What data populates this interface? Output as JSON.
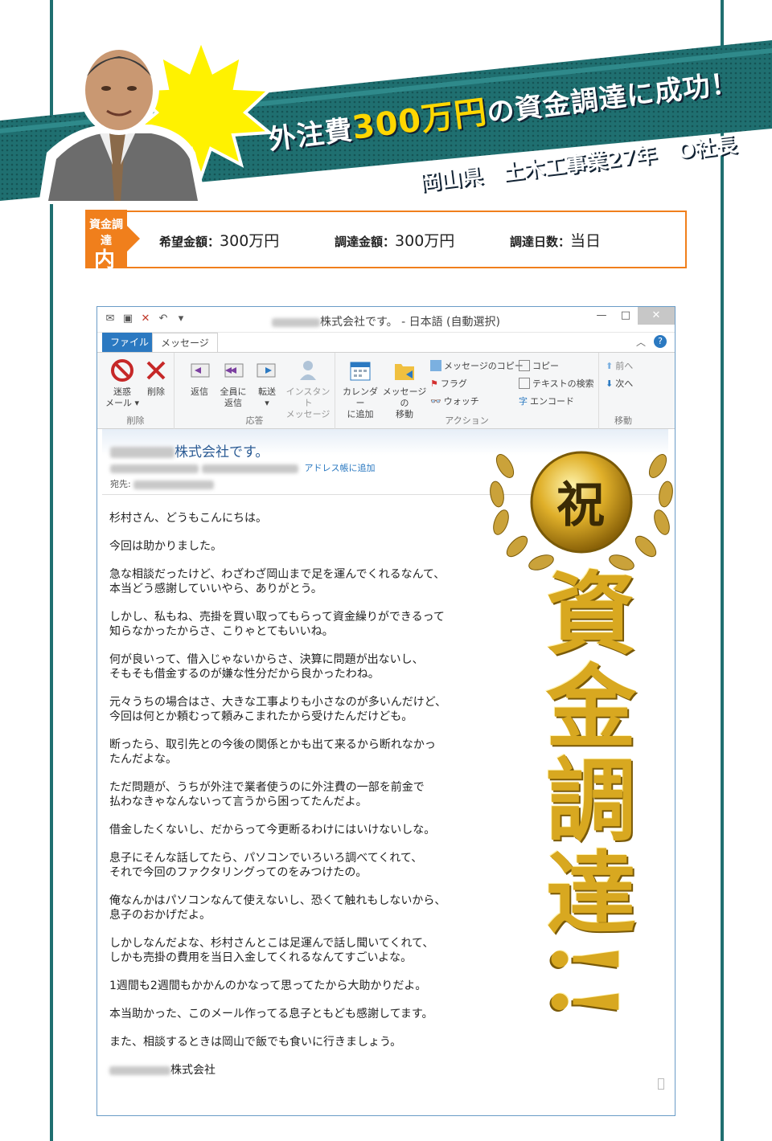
{
  "banner": {
    "title_prefix": "外注費",
    "title_amount": "300万円",
    "title_suffix": "の資金調達に成功！",
    "subtitle": "岡山県　土木工事業27年　O社長",
    "colors": {
      "band": "#1f6f70",
      "burst": "#fff200",
      "amount": "#ffd700"
    }
  },
  "info": {
    "tag_top": "資金調達",
    "tag_bottom": "内容",
    "items": [
      {
        "key": "希望金額：",
        "value": "300万円"
      },
      {
        "key": "調達金額：",
        "value": "300万円"
      },
      {
        "key": "調達日数：",
        "value": "当日"
      }
    ],
    "accent": "#f07f1c"
  },
  "window": {
    "title": "株式会社です。 - 日本語 (自動選択)",
    "tabs": [
      "ファイル",
      "メッセージ"
    ],
    "groups": {
      "delete": {
        "label": "削除",
        "junk": "迷惑\nメール ▾",
        "delete": "削除"
      },
      "respond": {
        "label": "応答",
        "reply": "返信",
        "reply_all": "全員に\n返信",
        "forward": "転送\n▾",
        "im": "インスタント\nメッセージ"
      },
      "actions": {
        "label": "アクション",
        "calendar": "カレンダー\nに追加",
        "move": "メッセージの\n移動",
        "copy_msg": "メッセージのコピー",
        "flag": "フラグ",
        "watch": "ウォッチ",
        "copy": "コピー",
        "search_text": "テキストの検索",
        "encode": "エンコード"
      },
      "move": {
        "label": "移動",
        "prev": "前へ",
        "next": "次へ"
      }
    },
    "message": {
      "sender": "株式会社です。",
      "add_to_addressbook": "アドレス帳に追加",
      "to_label": "宛先:",
      "paragraphs": [
        "杉村さん、どうもこんにちは。",
        "今回は助かりました。",
        "急な相談だったけど、わざわざ岡山まで足を運んでくれるなんて、\n本当どう感謝していいやら、ありがとう。",
        "しかし、私もね、売掛を買い取ってもらって資金繰りができるって\n知らなかったからさ、こりゃとてもいいね。",
        "何が良いって、借入じゃないからさ、決算に問題が出ないし、\nそもそも借金するのが嫌な性分だから良かったわね。",
        "元々うちの場合はさ、大きな工事よりも小さなのが多いんだけど、\n今回は何とか頼むって頼みこまれたから受けたんだけども。",
        "断ったら、取引先との今後の関係とかも出て来るから断れなかっ\nたんだよな。",
        "ただ問題が、うちが外注で業者使うのに外注費の一部を前金で\n払わなきゃなんないって言うから困ってたんだよ。",
        "借金したくないし、だからって今更断るわけにはいけないしな。",
        "息子にそんな話してたら、パソコンでいろいろ調べてくれて、\nそれで今回のファクタリングってのをみつけたの。",
        "俺なんかはパソコンなんて使えないし、恐くて触れもしないから、\n息子のおかげだよ。",
        "しかしなんだよな、杉村さんとこは足運んで話し聞いてくれて、\nしかも売掛の費用を当日入金してくれるなんてすごいよな。",
        "1週間も2週間もかかんのかなって思ってたから大助かりだよ。",
        "本当助かった、このメール作ってる息子ともども感謝してます。",
        "また、相談するときは岡山で飯でも食いに行きましょう。"
      ],
      "signature": "株式会社"
    }
  },
  "decoration": {
    "medal_char": "祝",
    "title": "資金調達!!",
    "gold": "#d8a820"
  }
}
